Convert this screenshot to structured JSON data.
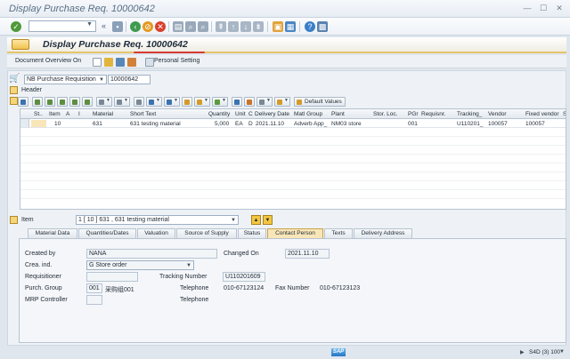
{
  "window": {
    "title": "Display Purchase Req. 10000642"
  },
  "toolbar": {
    "command_field": ""
  },
  "app": {
    "title": "Display Purchase Req. 10000642",
    "toolbar": {
      "document_overview": "Document Overview On",
      "personal_setting": "Personal Setting"
    }
  },
  "doc": {
    "type": "NB Purchase Requisition",
    "number": "10000642",
    "header_label": "Header"
  },
  "grid_toolbar": {
    "default_values": "Default Values"
  },
  "table": {
    "columns": [
      "St..",
      "Item",
      "A",
      "I",
      "Material",
      "Short Text",
      "Quantity",
      "Unit",
      "C",
      "Delivery Date",
      "Matl Group",
      "Plant",
      "Stor. Loc.",
      "PGr",
      "Requisnr.",
      "Tracking_",
      "Vendor",
      "Fixed vendor",
      "SP"
    ],
    "rows": [
      {
        "status": "",
        "item": "10",
        "a": "",
        "i": "",
        "material": "631",
        "short_text": "631 testing material",
        "quantity": "5,000",
        "unit": "EA",
        "c": "D",
        "delivery_date": "2021.11.10",
        "matl_group": "Adverb App_",
        "plant": "NM03 store",
        "stor_loc": "",
        "pgr": "001",
        "requisnr": "",
        "tracking": "U110201_",
        "vendor": "100057",
        "fixed_vendor": "100057",
        "sp": ""
      }
    ]
  },
  "item_selector": {
    "label": "Item",
    "value": "1 [ 10 ] 631 , 631 testing material"
  },
  "tabs": [
    "Material Data",
    "Quantities/Dates",
    "Valuation",
    "Source of Supply",
    "Status",
    "Contact Person",
    "Texts",
    "Delivery Address"
  ],
  "active_tab": "Contact Person",
  "contact": {
    "created_by_label": "Created by",
    "created_by": "NANA",
    "changed_on_label": "Changed On",
    "changed_on": "2021.11.10",
    "crea_ind_label": "Crea. ind.",
    "crea_ind": "G Store order",
    "requisitioner_label": "Requisitioner",
    "requisitioner": "",
    "tracking_label": "Tracking Number",
    "tracking": "U110201609",
    "purch_group_label": "Purch. Group",
    "purch_group_code": "001",
    "purch_group_name": "采购组001",
    "telephone_label": "Telephone",
    "telephone": "010-67123124",
    "fax_label": "Fax Number",
    "fax": "010-67123123",
    "mrp_label": "MRP Controller",
    "mrp": "",
    "telephone2_label": "Telephone",
    "telephone2": ""
  },
  "status": {
    "system": "S4D (3) 100",
    "sap_logo": "SAP"
  }
}
